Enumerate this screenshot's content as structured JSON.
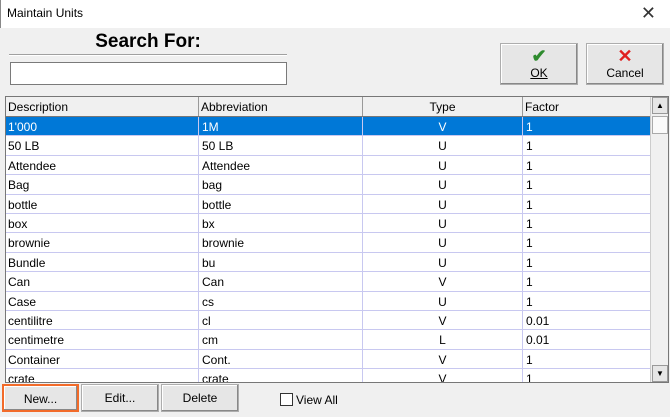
{
  "window": {
    "title": "Maintain Units",
    "close_icon": "close-x"
  },
  "search": {
    "label": "Search For:",
    "value": ""
  },
  "buttons": {
    "ok": "OK",
    "cancel": "Cancel",
    "new": "New...",
    "edit": "Edit...",
    "delete": "Delete",
    "view_all": "View All"
  },
  "table": {
    "headers": [
      "Description",
      "Abbreviation",
      "Type",
      "Factor"
    ],
    "rows": [
      [
        "1'000",
        "1M",
        "V",
        "1"
      ],
      [
        "50 LB",
        "50 LB",
        "U",
        "1"
      ],
      [
        "Attendee",
        "Attendee",
        "U",
        "1"
      ],
      [
        "Bag",
        "bag",
        "U",
        "1"
      ],
      [
        "bottle",
        "bottle",
        "U",
        "1"
      ],
      [
        "box",
        "bx",
        "U",
        "1"
      ],
      [
        "brownie",
        "brownie",
        "U",
        "1"
      ],
      [
        "Bundle",
        "bu",
        "U",
        "1"
      ],
      [
        "Can",
        "Can",
        "V",
        "1"
      ],
      [
        "Case",
        "cs",
        "U",
        "1"
      ],
      [
        "centilitre",
        "cl",
        "V",
        "0.01"
      ],
      [
        "centimetre",
        "cm",
        "L",
        "0.01"
      ],
      [
        "Container",
        "Cont.",
        "V",
        "1"
      ],
      [
        "crate",
        "crate",
        "V",
        "1"
      ]
    ],
    "selected_row": 0
  },
  "colors": {
    "selection": "#0078d7",
    "highlight_border": "#f26b2a"
  }
}
